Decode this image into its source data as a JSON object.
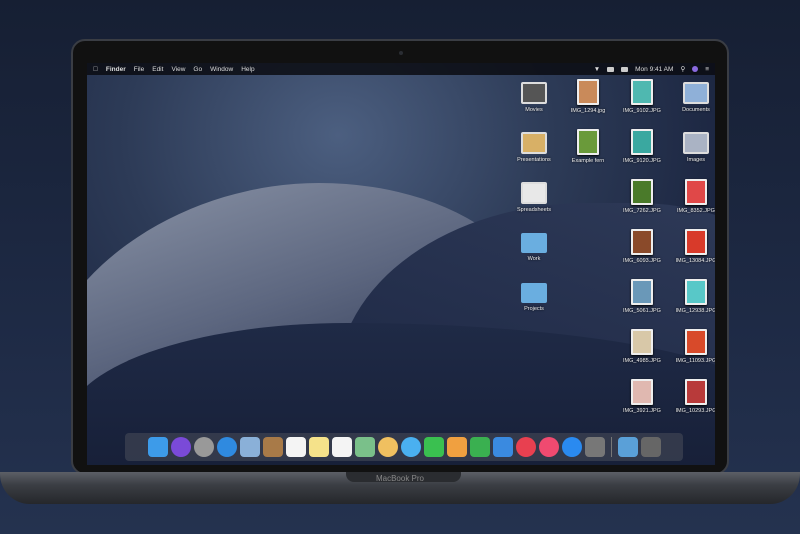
{
  "device_label": "MacBook Pro",
  "menubar": {
    "app": "Finder",
    "menus": [
      "File",
      "Edit",
      "View",
      "Go",
      "Window",
      "Help"
    ],
    "clock": "Mon 9:41 AM"
  },
  "desktop": [
    {
      "label": "Movies",
      "type": "stack",
      "color": "#555"
    },
    {
      "label": "IMG_1294.jpg",
      "type": "photo",
      "color": "#c98a5a"
    },
    {
      "label": "IMG_9102.JPG",
      "type": "photo",
      "color": "#4fb8b0"
    },
    {
      "label": "Documents",
      "type": "stack",
      "color": "#8fb0d8"
    },
    {
      "label": "Presentations",
      "type": "stack",
      "color": "#d8b066"
    },
    {
      "label": "Example fern",
      "type": "photo",
      "color": "#6a9a3a"
    },
    {
      "label": "IMG_9120.JPG",
      "type": "photo",
      "color": "#3aa8a0"
    },
    {
      "label": "Images",
      "type": "stack",
      "color": "#aab3c4"
    },
    {
      "label": "Spreadsheets",
      "type": "stack",
      "color": "#e8e8e8"
    },
    {
      "label": "IMG_7262.JPG",
      "type": "photo",
      "color": "#4a7a2a"
    },
    {
      "label": "IMG_8352.JPG",
      "type": "photo",
      "color": "#e04848"
    },
    {
      "label": "Work",
      "type": "folder"
    },
    {
      "label": "IMG_6093.JPG",
      "type": "photo",
      "color": "#8a4a2a"
    },
    {
      "label": "IMG_13084.JPG",
      "type": "photo",
      "color": "#d83a2a"
    },
    {
      "label": "Projects",
      "type": "folder"
    },
    {
      "label": "IMG_5061.JPG",
      "type": "photo",
      "color": "#6a98b8"
    },
    {
      "label": "IMG_12938.JPG",
      "type": "photo",
      "color": "#58c8c8"
    },
    {
      "label": "IMG_4985.JPG",
      "type": "photo",
      "color": "#d8c8a8"
    },
    {
      "label": "IMG_11093.JPG",
      "type": "photo",
      "color": "#d84a2a"
    },
    {
      "label": "IMG_3921.JPG",
      "type": "photo",
      "color": "#e0b8b0"
    },
    {
      "label": "IMG_10293.JPG",
      "type": "photo",
      "color": "#b83a3a"
    }
  ],
  "dock": [
    {
      "name": "finder",
      "color": "#3d9be9"
    },
    {
      "name": "siri",
      "color": "#7a4ad8"
    },
    {
      "name": "launchpad",
      "color": "#999"
    },
    {
      "name": "safari",
      "color": "#2f8ae0"
    },
    {
      "name": "mail",
      "color": "#8ab0d8"
    },
    {
      "name": "contacts",
      "color": "#a87a48"
    },
    {
      "name": "calendar",
      "color": "#f4f4f4"
    },
    {
      "name": "notes",
      "color": "#f5e28a"
    },
    {
      "name": "reminders",
      "color": "#f4f4f4"
    },
    {
      "name": "maps",
      "color": "#7ac08a"
    },
    {
      "name": "photos",
      "color": "#f0c060"
    },
    {
      "name": "messages",
      "color": "#4ab0f0"
    },
    {
      "name": "facetime",
      "color": "#3ac050"
    },
    {
      "name": "pages",
      "color": "#f0a040"
    },
    {
      "name": "numbers",
      "color": "#3ab050"
    },
    {
      "name": "keynote",
      "color": "#3a8ae0"
    },
    {
      "name": "news",
      "color": "#e84050"
    },
    {
      "name": "music",
      "color": "#f04a70"
    },
    {
      "name": "app-store",
      "color": "#2a8af0"
    },
    {
      "name": "system-preferences",
      "color": "#777"
    },
    {
      "name": "downloads",
      "color": "#5aa0d8"
    },
    {
      "name": "trash",
      "color": "#666"
    }
  ]
}
